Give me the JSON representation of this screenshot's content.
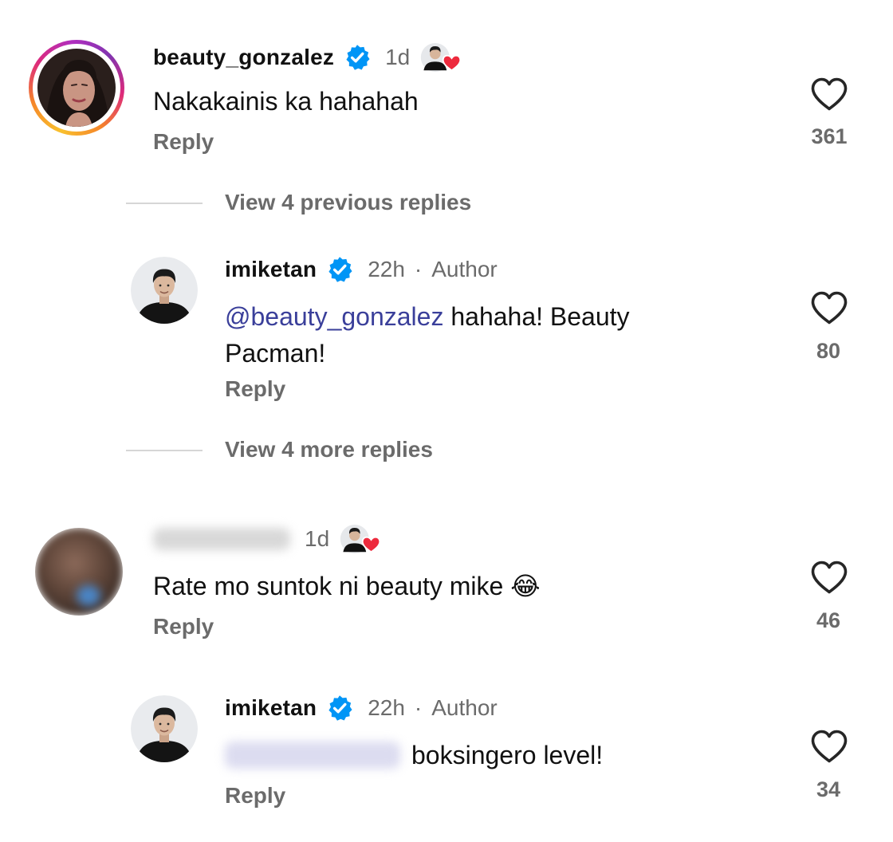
{
  "comments": [
    {
      "username": "beauty_gonzalez",
      "verified": true,
      "time": "1d",
      "text": "Nakakainis ka hahahah",
      "reply_label": "Reply",
      "likes": "361",
      "liked_by_author": true
    },
    {
      "username": "",
      "username_hidden": true,
      "time": "1d",
      "text": "Rate mo suntok ni beauty mike 😂",
      "reply_label": "Reply",
      "likes": "46",
      "liked_by_author": true
    }
  ],
  "threads": [
    {
      "view_label": "View 4 previous replies"
    },
    {
      "view_label": "View 4 more replies"
    }
  ],
  "replies": [
    {
      "username": "imiketan",
      "verified": true,
      "time": "22h",
      "separator": "·",
      "role": "Author",
      "mention": "@beauty_gonzalez",
      "text_line1": " hahaha! Beauty",
      "text_line2": "Pacman!",
      "reply_label": "Reply",
      "likes": "80"
    },
    {
      "username": "imiketan",
      "verified": true,
      "time": "22h",
      "separator": "·",
      "role": "Author",
      "mention_hidden": true,
      "text": "boksingero level!",
      "reply_label": "Reply",
      "likes": "34"
    }
  ],
  "colors": {
    "verified_badge": "#0095f6",
    "heart_badge": "#ed2a3d",
    "secondary_text": "#6b6b6b",
    "mention": "#3a3f9a"
  },
  "icons": {
    "verified": "verified-badge-icon",
    "like": "heart-outline-icon",
    "author_liked": "author-avatar-heart-icon"
  }
}
